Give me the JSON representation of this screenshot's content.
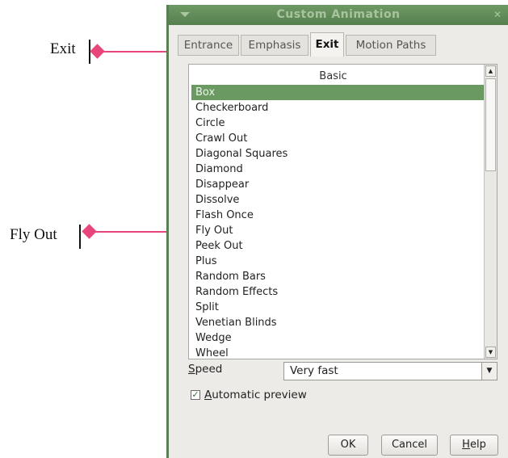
{
  "annotations": {
    "exit_label": "Exit",
    "fly_out_label": "Fly Out",
    "marker_color": "#e8457a"
  },
  "dialog": {
    "title": "Custom Animation",
    "tabs": [
      "Entrance",
      "Emphasis",
      "Exit",
      "Motion Paths"
    ],
    "active_tab": "Exit",
    "list_header": "Basic",
    "effects": [
      "Box",
      "Checkerboard",
      "Circle",
      "Crawl Out",
      "Diagonal Squares",
      "Diamond",
      "Disappear",
      "Dissolve",
      "Flash Once",
      "Fly Out",
      "Peek Out",
      "Plus",
      "Random Bars",
      "Random Effects",
      "Split",
      "Venetian Blinds",
      "Wedge",
      "Wheel"
    ],
    "selected_effect": "Box",
    "speed_label_mnemonic": "S",
    "speed_label_rest": "peed",
    "speed_value": "Very fast",
    "auto_preview_mnemonic": "A",
    "auto_preview_rest": "utomatic preview",
    "auto_preview_checked": true,
    "ok_label": "OK",
    "cancel_label": "Cancel",
    "help_mnemonic": "H",
    "help_rest": "elp",
    "accent_color": "#6a9a61"
  }
}
